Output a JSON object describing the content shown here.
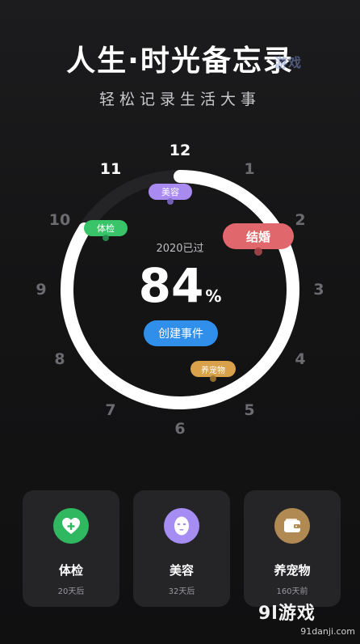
{
  "header": {
    "title": "人生·时光备忘录",
    "subtitle": "轻松记录生活大事"
  },
  "watermark": {
    "top_text": "游戏",
    "brand": "9l游戏",
    "domain": "91danji.com"
  },
  "dial": {
    "hours": [
      "1",
      "2",
      "3",
      "4",
      "5",
      "6",
      "7",
      "8",
      "9",
      "10",
      "11",
      "12"
    ],
    "highlighted_hours": [
      "11",
      "12"
    ],
    "progress_percent": 84,
    "year_label": "2020已过",
    "percent_value": "84",
    "percent_unit": "%",
    "create_button": "创建事件"
  },
  "tags": {
    "meirong": {
      "label": "美容",
      "color": "#a98af0"
    },
    "tijian": {
      "label": "体检",
      "color": "#39c46a"
    },
    "jiehun": {
      "label": "结婚",
      "color": "#e0676b"
    },
    "yangchongwu": {
      "label": "养宠物",
      "color": "#d9a24a"
    }
  },
  "cards": [
    {
      "name": "体检",
      "days": "20天后",
      "icon": "heart-plus-icon",
      "color": "#2fb85f"
    },
    {
      "name": "美容",
      "days": "32天后",
      "icon": "face-mask-icon",
      "color": "#a58df3"
    },
    {
      "name": "养宠物",
      "days": "160天前",
      "icon": "wallet-icon",
      "color": "#b08a52"
    }
  ]
}
